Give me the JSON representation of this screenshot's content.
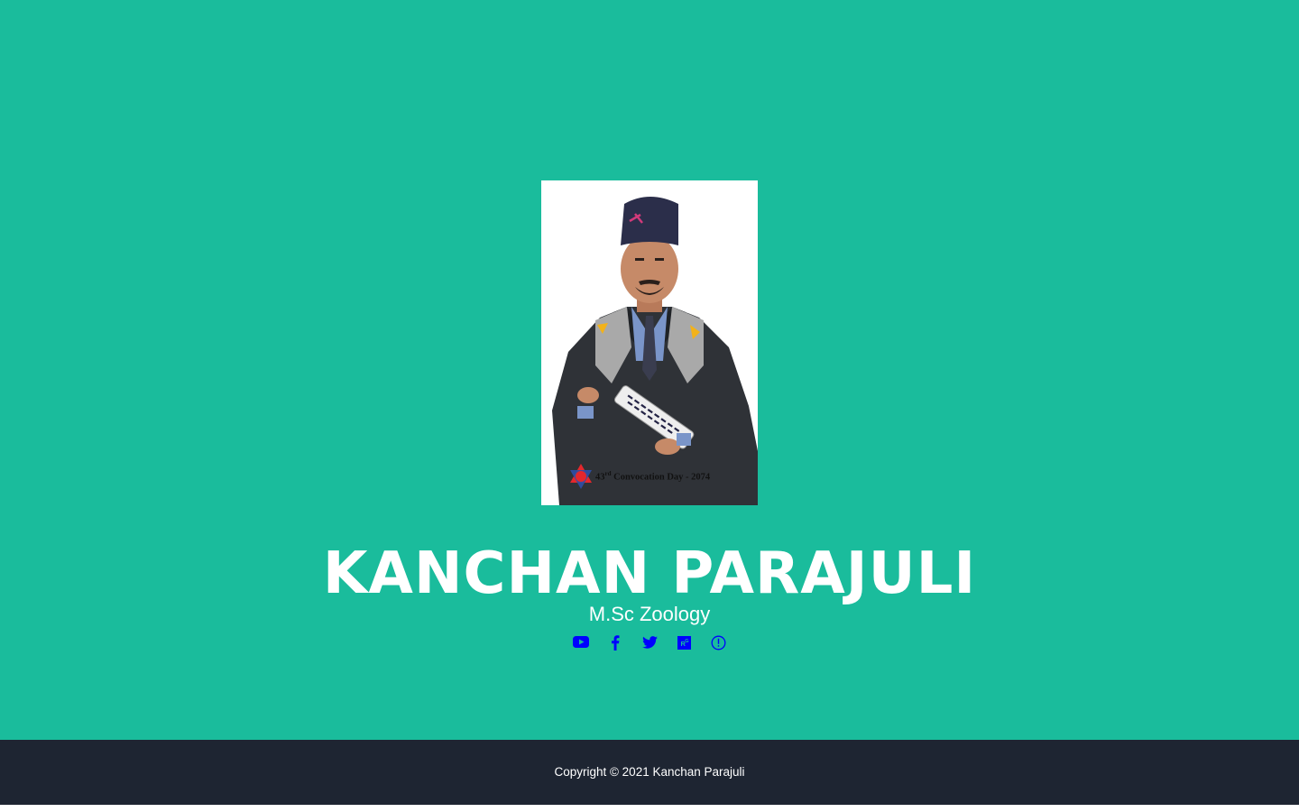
{
  "profile": {
    "name": "KANCHAN PARAJULI",
    "degree": "M.Sc Zoology",
    "photo_caption_number": "43",
    "photo_caption_suffix": "rd",
    "photo_caption_rest": " Convocation Day - 2074"
  },
  "social": [
    {
      "icon": "youtube-icon"
    },
    {
      "icon": "facebook-icon"
    },
    {
      "icon": "twitter-icon"
    },
    {
      "icon": "researchgate-icon"
    },
    {
      "icon": "info-icon"
    }
  ],
  "footer": {
    "copyright": "Copyright © 2021 Kanchan Parajuli"
  },
  "colors": {
    "hero_background": "#1abc9c",
    "footer_background": "#1e2532",
    "icon_color": "#0000ff",
    "text": "#ffffff"
  }
}
